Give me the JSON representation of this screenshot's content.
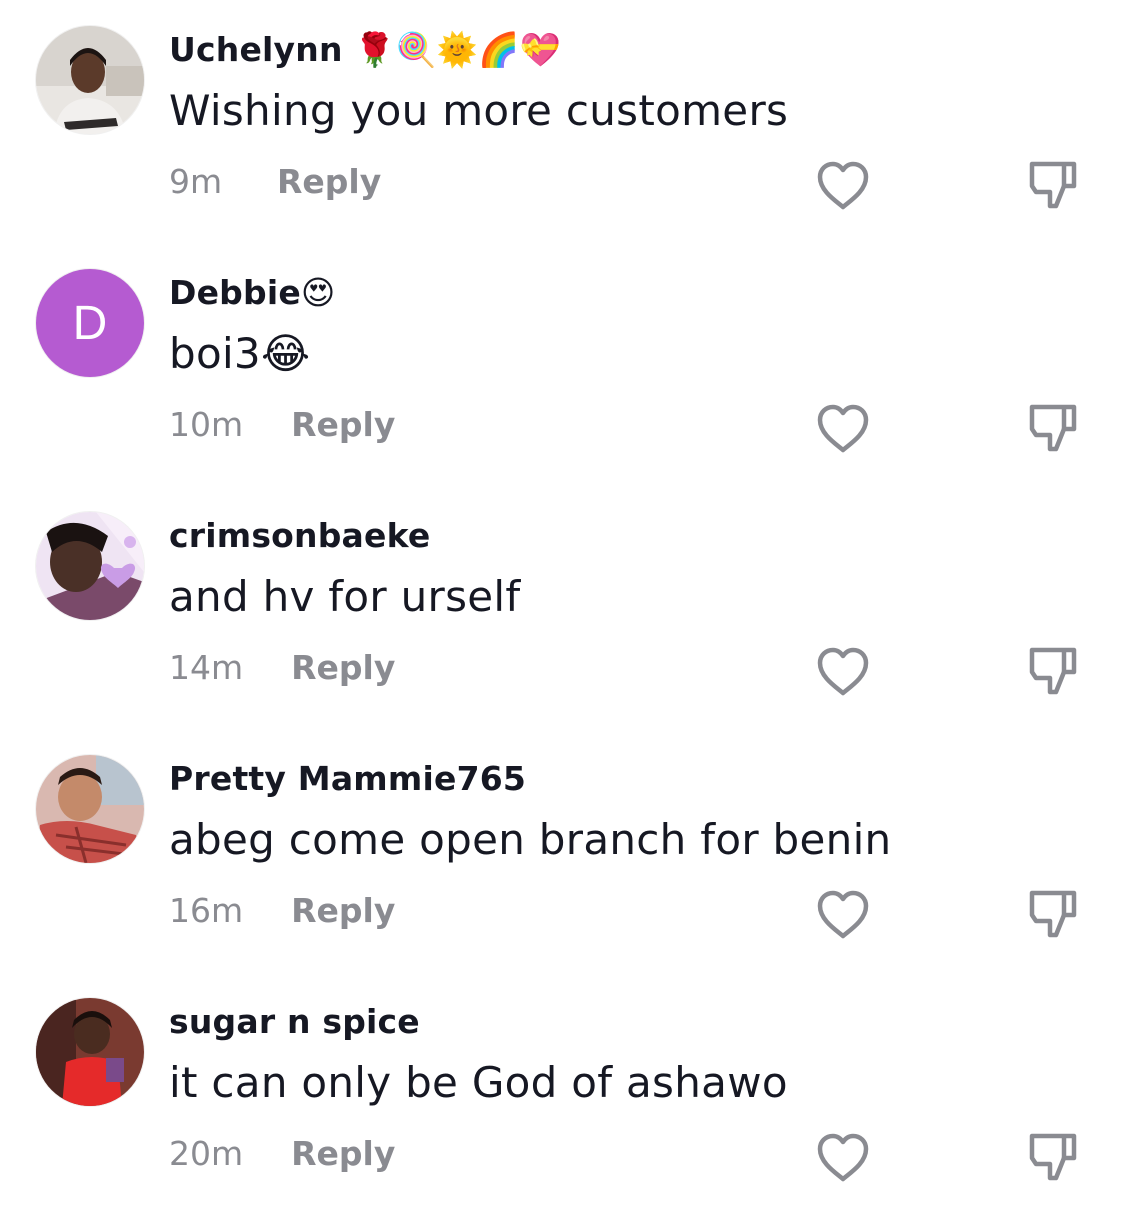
{
  "comments": [
    {
      "username": "Uchelynn 🌹🍭🌞🌈💝",
      "text": "Wishing you more customers",
      "time": "9m",
      "reply_label": "Reply",
      "avatar": "photo"
    },
    {
      "username": "Debbie😍",
      "text": "boi3😂",
      "time": "10m",
      "reply_label": "Reply",
      "avatar_letter": "D",
      "avatar_color": "#b55bd1"
    },
    {
      "username": "crimsonbaeke",
      "text": "and hv for urself",
      "time": "14m",
      "reply_label": "Reply",
      "avatar": "photo"
    },
    {
      "username": "Pretty Mammie765",
      "text": "abeg come open branch for benin",
      "time": "16m",
      "reply_label": "Reply",
      "avatar": "photo"
    },
    {
      "username": "sugar n spice",
      "text": "it can only be God of ashawo",
      "time": "20m",
      "reply_label": "Reply",
      "avatar": "photo"
    }
  ],
  "icons": {
    "like": "heart-outline-icon",
    "dislike": "thumbs-down-outline-icon"
  },
  "colors": {
    "text": "#161823",
    "secondary": "#8a8b91",
    "icon": "#8a8b91"
  }
}
